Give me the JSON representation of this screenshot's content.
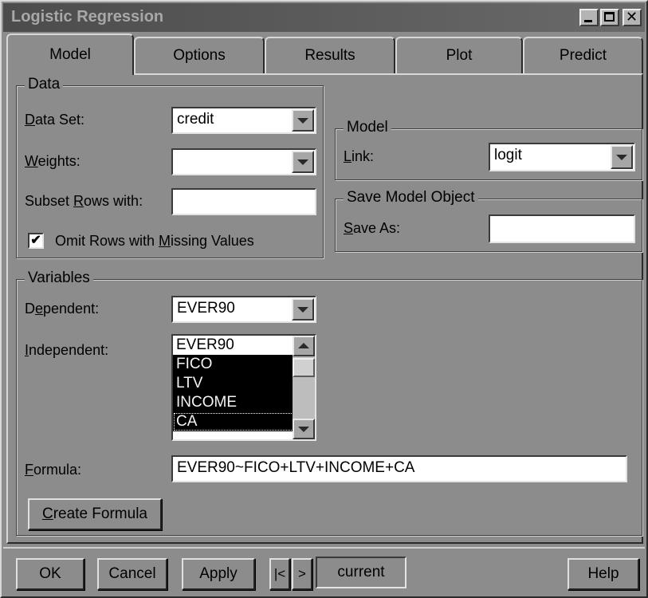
{
  "window": {
    "title": "Logistic Regression",
    "controls": {
      "minimize": "minimize-icon",
      "maximize": "maximize-icon",
      "close": "close-icon"
    }
  },
  "tabs": [
    {
      "label": "Model",
      "active": true
    },
    {
      "label": "Options",
      "active": false
    },
    {
      "label": "Results",
      "active": false
    },
    {
      "label": "Plot",
      "active": false
    },
    {
      "label": "Predict",
      "active": false
    }
  ],
  "data_group": {
    "title": "Data",
    "data_set": {
      "label_prefix": "",
      "label_underline": "D",
      "label_rest": "ata Set:",
      "value": "credit"
    },
    "weights": {
      "label_underline": "W",
      "label_rest": "eights:",
      "value": ""
    },
    "subset": {
      "label_prefix": "Subset ",
      "label_underline": "R",
      "label_rest": "ows with:",
      "value": ""
    },
    "omit": {
      "checked": true,
      "check_mark": "✔",
      "label_prefix": "Omit Rows with ",
      "label_underline": "M",
      "label_rest": "issing Values"
    }
  },
  "model_group": {
    "title": "Model",
    "link": {
      "label_underline": "L",
      "label_rest": "ink:",
      "value": "logit"
    }
  },
  "save_group": {
    "title": "Save Model Object",
    "save_as": {
      "label_underline": "S",
      "label_rest": "ave As:",
      "value": ""
    }
  },
  "variables_group": {
    "title": "Variables",
    "dependent": {
      "label_prefix": "D",
      "label_underline": "e",
      "label_rest": "pendent:",
      "value": "EVER90"
    },
    "independent": {
      "label_underline": "I",
      "label_rest": "ndependent:",
      "items": [
        {
          "text": "EVER90",
          "selected": false
        },
        {
          "text": "FICO",
          "selected": true
        },
        {
          "text": "LTV",
          "selected": true
        },
        {
          "text": "INCOME",
          "selected": true
        },
        {
          "text": "CA",
          "selected": true
        }
      ]
    },
    "formula": {
      "label_underline": "F",
      "label_rest": "ormula:",
      "value": "EVER90~FICO+LTV+INCOME+CA"
    },
    "create_formula": {
      "label_underline": "C",
      "label_rest": "reate Formula"
    }
  },
  "bottom": {
    "ok": "OK",
    "cancel": "Cancel",
    "apply": "Apply",
    "nav_first": "|<",
    "nav_next": ">",
    "current": "current",
    "help": "Help"
  },
  "colors": {
    "face": "#8c8c8c",
    "title_bar": "#4c4c4c",
    "selection": "#000000"
  }
}
